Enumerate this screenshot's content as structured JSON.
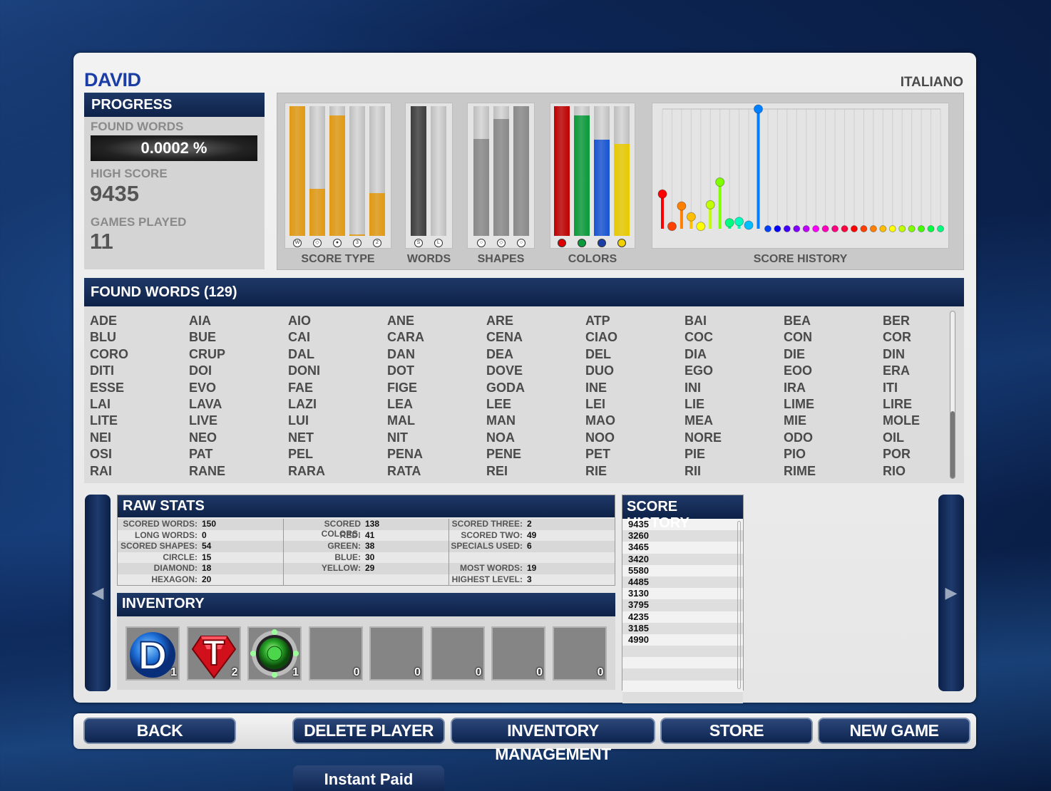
{
  "player": {
    "name": "DAVID",
    "language": "ITALIANO"
  },
  "progress": {
    "header": "PROGRESS",
    "found_words_label": "FOUND WORDS",
    "found_words_pct": "0.0002 %",
    "high_score_label": "HIGH SCORE",
    "high_score": "9435",
    "games_played_label": "GAMES PLAYED",
    "games_played": "11"
  },
  "charts": {
    "score_type": {
      "label": "SCORE TYPE",
      "levels": [
        1.0,
        0.36,
        0.93,
        0.01,
        0.33
      ],
      "colors": [
        "#e39a12",
        "#e39a12",
        "#e39a12",
        "#e39a12",
        "#e39a12"
      ],
      "icons": [
        "W",
        "◇",
        "●",
        "3",
        "2"
      ]
    },
    "words": {
      "label": "WORDS",
      "levels": [
        1.0,
        0.0
      ],
      "colors": [
        "#3e3e3e",
        "#3e3e3e"
      ],
      "icons": [
        "S",
        "L"
      ]
    },
    "shapes": {
      "label": "SHAPES",
      "levels": [
        0.75,
        0.9,
        1.0
      ],
      "colors": [
        "#8a8a8a",
        "#8a8a8a",
        "#8a8a8a"
      ],
      "icons": [
        "○",
        "◇",
        "○"
      ]
    },
    "colors": {
      "label": "COLORS",
      "levels": [
        1.0,
        0.93,
        0.74,
        0.71
      ],
      "colors": [
        "#c00000",
        "#0a9a3a",
        "#1654d4",
        "#eacb00"
      ],
      "icons": [
        "●",
        "●",
        "●",
        "●"
      ],
      "icon_colors": [
        "#d00",
        "#0a9a3a",
        "#1b3ea8",
        "#f0d000"
      ]
    },
    "score_history": {
      "label": "SCORE HISTORY"
    }
  },
  "chart_data": {
    "type": "scatter",
    "title": "SCORE HISTORY",
    "values": [
      0.29,
      0.02,
      0.19,
      0.1,
      0.02,
      0.2,
      0.39,
      0.05,
      0.06,
      0.03,
      1.0,
      0,
      0,
      0,
      0,
      0,
      0,
      0,
      0,
      0,
      0,
      0,
      0,
      0,
      0,
      0,
      0,
      0,
      0,
      0
    ],
    "colors": [
      "#ff0000",
      "#ff4000",
      "#ff8000",
      "#ffbf00",
      "#ffff00",
      "#bfff00",
      "#80ff00",
      "#00ff80",
      "#00ffbf",
      "#00bfff",
      "#0080ff",
      "#0040ff",
      "#0000ff",
      "#4000ff",
      "#8000ff",
      "#bf00ff",
      "#ff00ff",
      "#ff00bf",
      "#ff0080",
      "#ff0040",
      "#ff0000",
      "#ff4000",
      "#ff8000",
      "#ffbf00",
      "#ffff00",
      "#bfff00",
      "#80ff00",
      "#40ff00",
      "#00ff40",
      "#00ff80"
    ]
  },
  "found_words": {
    "header": "FOUND WORDS",
    "count": "(129)",
    "words": [
      "ADE",
      "AIA",
      "AIO",
      "ANE",
      "ARE",
      "ATP",
      "BAI",
      "BEA",
      "BER",
      "BLU",
      "BUE",
      "CAI",
      "CARA",
      "CENA",
      "CIAO",
      "COC",
      "CON",
      "COR",
      "CORO",
      "CRUP",
      "DAL",
      "DAN",
      "DEA",
      "DEL",
      "DIA",
      "DIE",
      "DIN",
      "DITI",
      "DOI",
      "DONI",
      "DOT",
      "DOVE",
      "DUO",
      "EGO",
      "EOO",
      "ERA",
      "ESSE",
      "EVO",
      "FAE",
      "FIGE",
      "GODA",
      "INE",
      "INI",
      "IRA",
      "ITI",
      "LAI",
      "LAVA",
      "LAZI",
      "LEA",
      "LEE",
      "LEI",
      "LIE",
      "LIME",
      "LIRE",
      "LITE",
      "LIVE",
      "LUI",
      "MAL",
      "MAN",
      "MAO",
      "MEA",
      "MIE",
      "MOLE",
      "NEI",
      "NEO",
      "NET",
      "NIT",
      "NOA",
      "NOO",
      "NORE",
      "ODO",
      "OIL",
      "OSI",
      "PAT",
      "PEL",
      "PENA",
      "PENE",
      "PET",
      "PIE",
      "PIO",
      "POR",
      "RAI",
      "RANE",
      "RARA",
      "RATA",
      "REI",
      "RIE",
      "RII",
      "RIME",
      "RIO"
    ]
  },
  "raw_stats": {
    "header": "RAW STATS",
    "col1": [
      {
        "k": "SCORED WORDS:",
        "v": "150"
      },
      {
        "k": "LONG WORDS:",
        "v": "0"
      },
      {
        "k": "SCORED SHAPES:",
        "v": "54"
      },
      {
        "k": "CIRCLE:",
        "v": "15"
      },
      {
        "k": "DIAMOND:",
        "v": "18"
      },
      {
        "k": "HEXAGON:",
        "v": "20"
      }
    ],
    "col2": [
      {
        "k": "SCORED COLORS:",
        "v": "138"
      },
      {
        "k": "RED:",
        "v": "41"
      },
      {
        "k": "GREEN:",
        "v": "38"
      },
      {
        "k": "BLUE:",
        "v": "30"
      },
      {
        "k": "YELLOW:",
        "v": "29"
      },
      {
        "k": "",
        "v": ""
      }
    ],
    "col3": [
      {
        "k": "SCORED THREE:",
        "v": "2"
      },
      {
        "k": "SCORED TWO:",
        "v": "49"
      },
      {
        "k": "SPECIALS USED:",
        "v": "6"
      },
      {
        "k": "",
        "v": ""
      },
      {
        "k": "MOST WORDS:",
        "v": "19"
      },
      {
        "k": "HIGHEST LEVEL:",
        "v": "3"
      }
    ]
  },
  "inventory": {
    "header": "INVENTORY",
    "slots": [
      {
        "icon": "d-orb-icon",
        "count": "1"
      },
      {
        "icon": "t-gem-icon",
        "count": "2"
      },
      {
        "icon": "green-orb-icon",
        "count": "1"
      },
      {
        "icon": "empty-slot",
        "count": "0"
      },
      {
        "icon": "empty-slot",
        "count": "0"
      },
      {
        "icon": "empty-slot",
        "count": "0"
      },
      {
        "icon": "empty-slot",
        "count": "0"
      },
      {
        "icon": "empty-slot",
        "count": "0"
      }
    ]
  },
  "score_history_list": {
    "header": "SCORE HISTORY",
    "scores": [
      "9435",
      "3260",
      "3465",
      "3420",
      "5580",
      "4485",
      "3130",
      "3795",
      "4235",
      "3185",
      "4990",
      "",
      "",
      "",
      "",
      ""
    ]
  },
  "buttons": {
    "back": "BACK",
    "delete_player": "DELETE PLAYER",
    "inventory_management": "INVENTORY MANAGEMENT",
    "store": "STORE",
    "new_game": "NEW GAME",
    "instant_paid": "Instant Paid"
  },
  "arrows": {
    "left": "◀",
    "right": "▶"
  }
}
